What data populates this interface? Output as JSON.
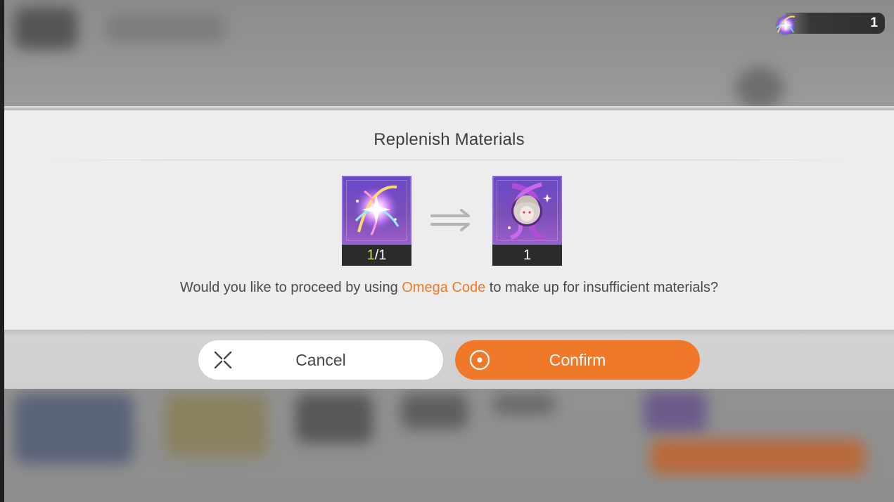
{
  "currency": {
    "icon": "omega-code-icon",
    "count": "1"
  },
  "dialog": {
    "title": "Replenish Materials",
    "cost_item": {
      "icon": "omega-code-icon",
      "have": "1",
      "separator": "/",
      "need": "1"
    },
    "result_item": {
      "icon": "character-fragment-icon",
      "quantity": "1"
    },
    "arrow_icon": "double-arrow-right-icon",
    "question": {
      "before": "Would you like to proceed by using ",
      "highlight": "Omega Code",
      "after": " to make up for insufficient materials?"
    },
    "cancel_label": "Cancel",
    "confirm_label": "Confirm"
  },
  "colors": {
    "accent": "#ef7829",
    "highlight_text": "#ef7a2a",
    "have_count": "#b6e34a",
    "dialog_bg": "#ededed"
  }
}
